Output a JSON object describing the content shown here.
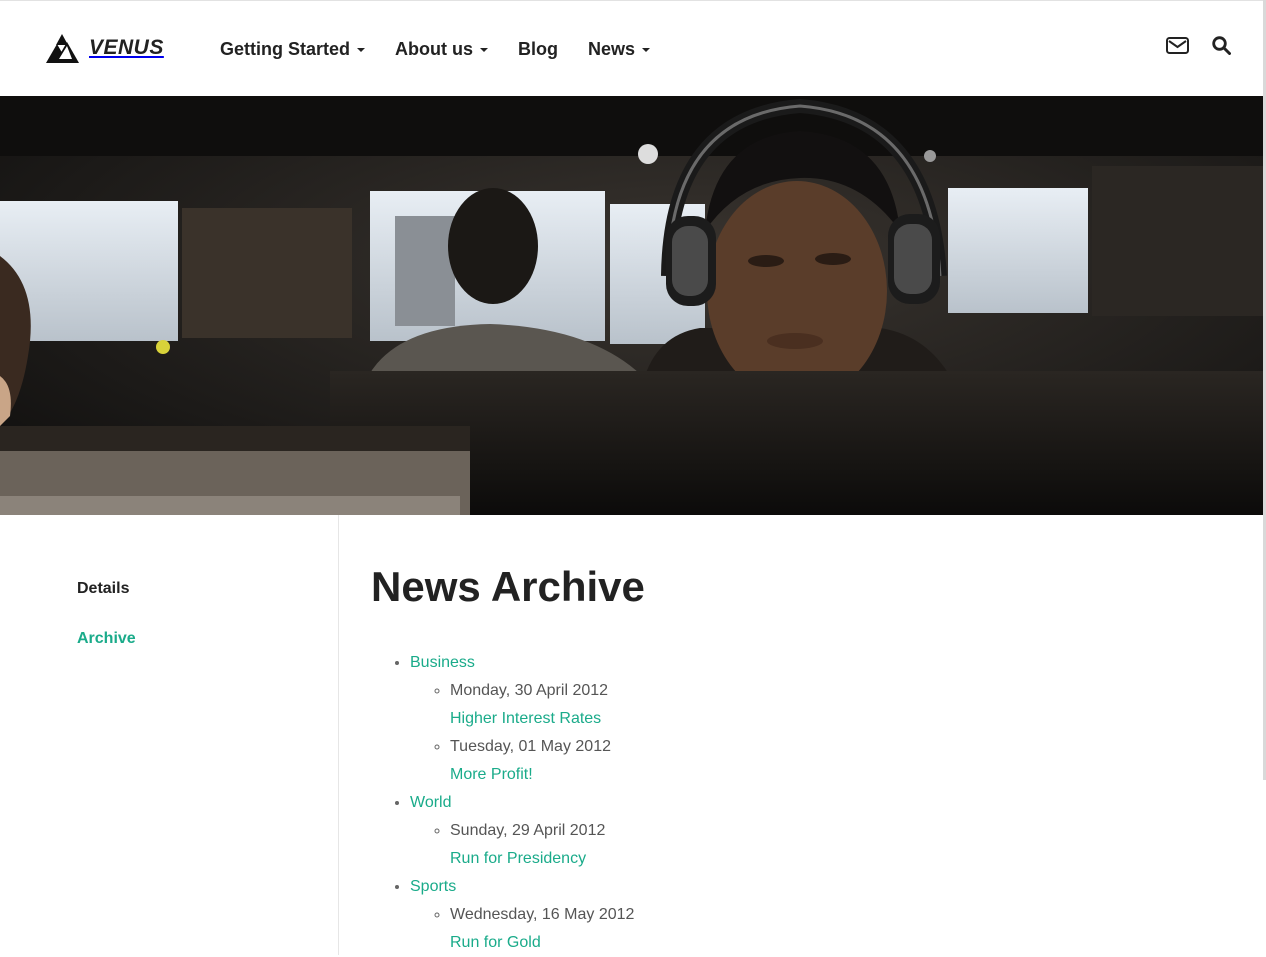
{
  "brand": {
    "name": "VENUS"
  },
  "nav": {
    "items": [
      {
        "label": "Getting Started",
        "dropdown": true
      },
      {
        "label": "About us",
        "dropdown": true
      },
      {
        "label": "Blog",
        "dropdown": false
      },
      {
        "label": "News",
        "dropdown": true
      }
    ]
  },
  "header_icons": [
    "envelope-icon",
    "search-icon"
  ],
  "sidebar": {
    "items": [
      {
        "label": "Details",
        "active": false
      },
      {
        "label": "Archive",
        "active": true
      }
    ]
  },
  "page": {
    "title": "News Archive"
  },
  "archive": [
    {
      "category": "Business",
      "entries": [
        {
          "date": "Monday, 30 April 2012",
          "title": "Higher Interest Rates"
        },
        {
          "date": "Tuesday, 01 May 2012",
          "title": "More Profit!"
        }
      ]
    },
    {
      "category": "World",
      "entries": [
        {
          "date": "Sunday, 29 April 2012",
          "title": "Run for Presidency"
        }
      ]
    },
    {
      "category": "Sports",
      "entries": [
        {
          "date": "Wednesday, 16 May 2012",
          "title": "Run for Gold"
        }
      ]
    }
  ],
  "colors": {
    "accent": "#1aab8a",
    "text": "#222222",
    "muted": "#666666"
  }
}
